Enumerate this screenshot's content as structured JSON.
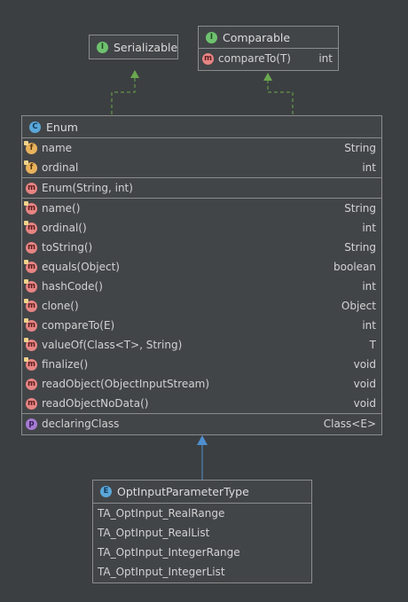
{
  "serializable": {
    "name": "Serializable",
    "kind": "interface",
    "icon": "interface-icon"
  },
  "comparable": {
    "name": "Comparable",
    "kind": "interface",
    "icon": "interface-icon",
    "methods": [
      {
        "name": "compareTo(T)",
        "type": "int"
      }
    ]
  },
  "enum_class": {
    "name": "Enum",
    "kind": "class",
    "fields": [
      {
        "name": "name",
        "type": "String"
      },
      {
        "name": "ordinal",
        "type": "int"
      }
    ],
    "constructors": [
      {
        "name": "Enum(String, int)",
        "type": ""
      }
    ],
    "methods": [
      {
        "name": "name()",
        "type": "String"
      },
      {
        "name": "ordinal()",
        "type": "int"
      },
      {
        "name": "toString()",
        "type": "String"
      },
      {
        "name": "equals(Object)",
        "type": "boolean"
      },
      {
        "name": "hashCode()",
        "type": "int"
      },
      {
        "name": "clone()",
        "type": "Object"
      },
      {
        "name": "compareTo(E)",
        "type": "int"
      },
      {
        "name": "valueOf(Class<T>, String)",
        "type": "T"
      },
      {
        "name": "finalize()",
        "type": "void"
      },
      {
        "name": "readObject(ObjectInputStream)",
        "type": "void"
      },
      {
        "name": "readObjectNoData()",
        "type": "void"
      }
    ],
    "properties": [
      {
        "name": "declaringClass",
        "type": "Class<E>"
      }
    ]
  },
  "opt_enum": {
    "name": "OptInputParameterType",
    "kind": "enum",
    "constants": [
      "TA_OptInput_RealRange",
      "TA_OptInput_RealList",
      "TA_OptInput_IntegerRange",
      "TA_OptInput_IntegerList"
    ]
  },
  "icon_letters": {
    "interface": "I",
    "class": "C",
    "enum": "E",
    "method": "m",
    "field": "f",
    "property": "p"
  },
  "colors": {
    "background": "#3c3f41",
    "box": "#424548",
    "border": "#8a8c8e",
    "implements_arrow": "#6aa84f",
    "extends_arrow": "#4e8fd0"
  }
}
